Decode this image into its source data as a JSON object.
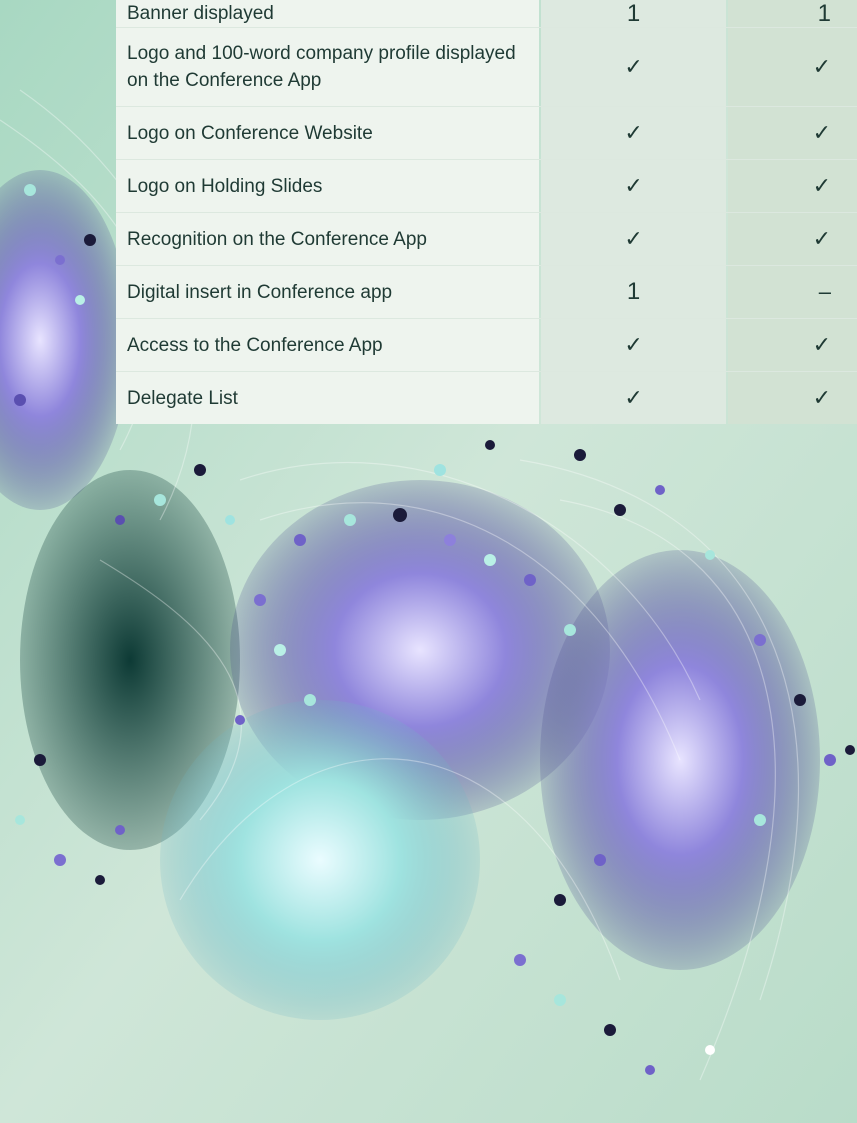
{
  "benefits_table": {
    "rows": [
      {
        "label": "Banner displayed",
        "col_a": "1",
        "col_b": "1"
      },
      {
        "label": "Logo and 100-word company profile displayed on the Conference App",
        "col_a": "✓",
        "col_b": "✓"
      },
      {
        "label": "Logo on Conference Website",
        "col_a": "✓",
        "col_b": "✓"
      },
      {
        "label": "Logo on Holding Slides",
        "col_a": "✓",
        "col_b": "✓"
      },
      {
        "label": "Recognition on the Conference App",
        "col_a": "✓",
        "col_b": "✓"
      },
      {
        "label": "Digital insert in Conference app",
        "col_a": "1",
        "col_b": "–"
      },
      {
        "label": "Access to the Conference App",
        "col_a": "✓",
        "col_b": "✓"
      },
      {
        "label": "Delegate List",
        "col_a": "✓",
        "col_b": "✓"
      }
    ]
  },
  "colors": {
    "background": "#cfe5d9",
    "label_cell": "#eef4ee",
    "column_a": "#dde9e0",
    "column_b": "#d2e2d3",
    "text": "#1f3a34",
    "accent_purple": "#6b5fc4",
    "accent_teal": "#7fd9c4"
  },
  "decoration": {
    "image_subject": "abstract flowing fiber strands with spheres",
    "icon": "decorative-artwork"
  }
}
